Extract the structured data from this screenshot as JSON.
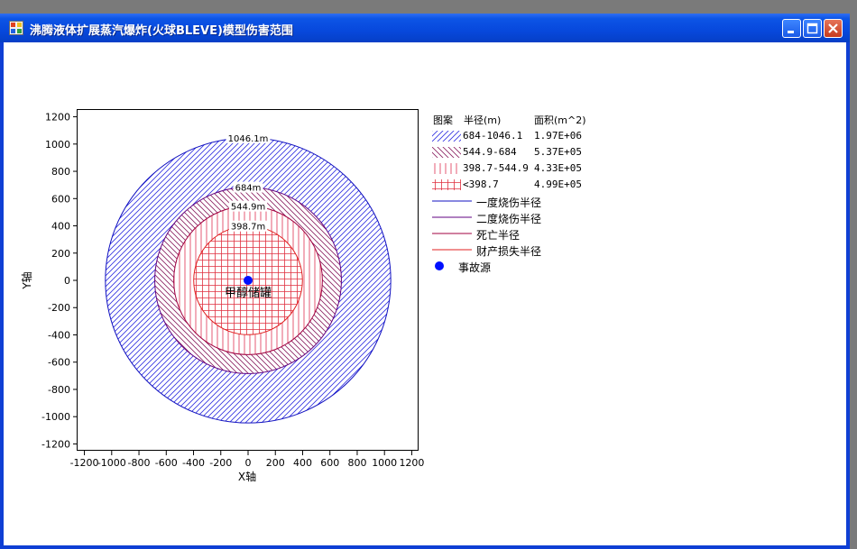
{
  "window": {
    "title": "沸腾液体扩展蒸汽爆炸(火球BLEVE)模型伤害范围"
  },
  "colors": {
    "band1": "#3030e0",
    "band2": "#8a2060",
    "band3": "#e03050",
    "band4": "#e03040",
    "circle1": "#1010c0",
    "circle2": "#600080",
    "circle3": "#a00040",
    "circle4": "#e02020",
    "source": "#0010ff"
  },
  "chart_data": {
    "type": "scatter",
    "xlabel": "X轴",
    "ylabel": "Y轴",
    "xlim": [
      -1250,
      1250
    ],
    "ylim": [
      -1250,
      1250
    ],
    "xticks": [
      -1200,
      -1000,
      -800,
      -600,
      -400,
      -200,
      0,
      200,
      400,
      600,
      800,
      1000,
      1200
    ],
    "yticks": [
      1200,
      1000,
      800,
      600,
      400,
      200,
      0,
      -200,
      -400,
      -600,
      -800,
      -1000,
      -1200
    ],
    "rings": [
      {
        "radius": 1046.1,
        "label": "1046.1m"
      },
      {
        "radius": 684,
        "label": "684m"
      },
      {
        "radius": 544.9,
        "label": "544.9m"
      },
      {
        "radius": 398.7,
        "label": "398.7m"
      }
    ],
    "source": {
      "x": 0,
      "y": 0,
      "label": "甲醇储罐"
    }
  },
  "legend": {
    "headers": {
      "pattern": "图案",
      "radius": "半径(m)",
      "area": "面积(m^2)"
    },
    "bands": [
      {
        "range": "684-1046.1",
        "area": "1.97E+06"
      },
      {
        "range": "544.9-684",
        "area": "5.37E+05"
      },
      {
        "range": "398.7-544.9",
        "area": "4.33E+05"
      },
      {
        "range": "<398.7",
        "area": "4.99E+05"
      }
    ],
    "lines": [
      {
        "label": "一度烧伤半径"
      },
      {
        "label": "二度烧伤半径"
      },
      {
        "label": "死亡半径"
      },
      {
        "label": "财产损失半径"
      }
    ],
    "source_label": "事故源"
  }
}
